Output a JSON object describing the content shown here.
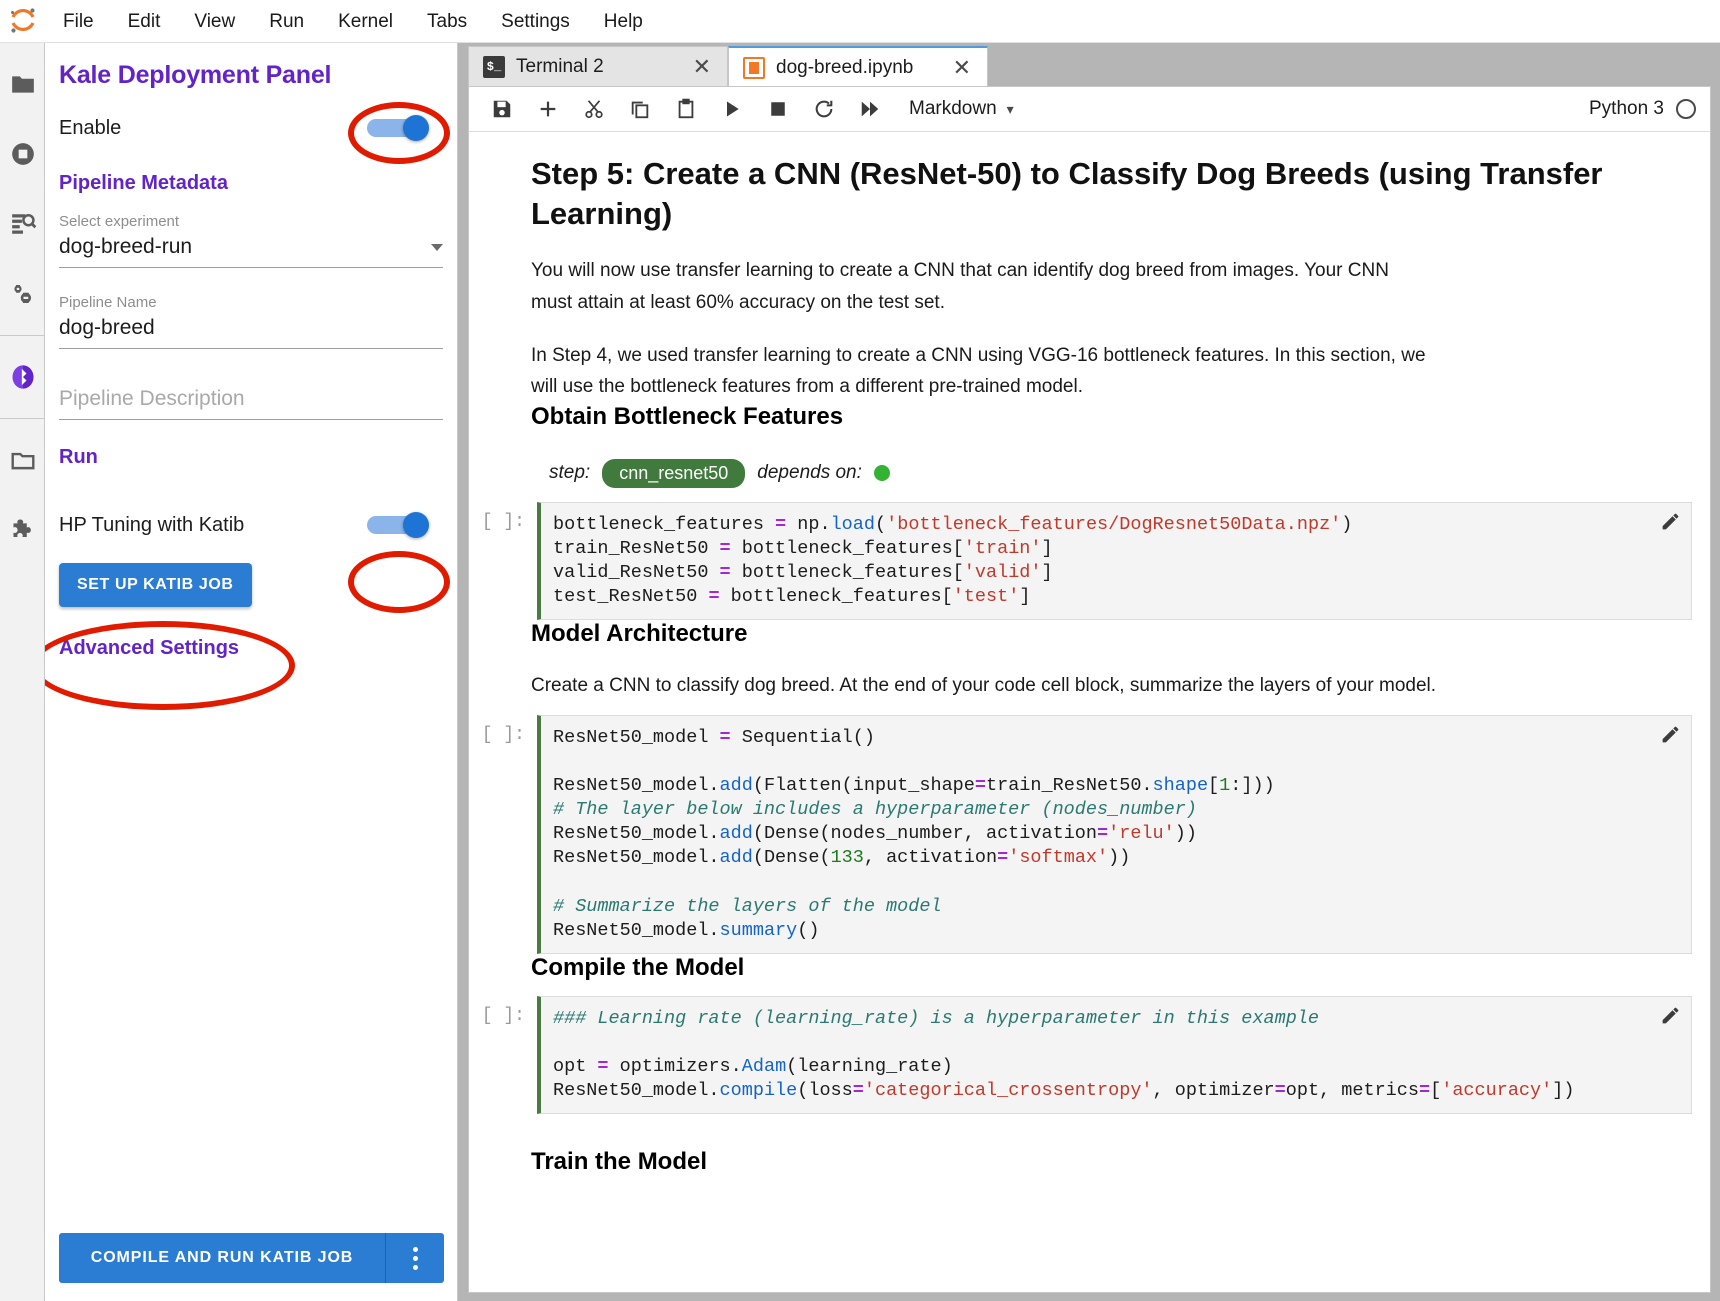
{
  "menubar": {
    "logo_name": "jupyter-logo",
    "items": [
      "File",
      "Edit",
      "View",
      "Run",
      "Kernel",
      "Tabs",
      "Settings",
      "Help"
    ]
  },
  "activitybar": {
    "items": [
      {
        "name": "file-browser-icon",
        "label": "Folder"
      },
      {
        "name": "running-terminals-icon",
        "label": "Running"
      },
      {
        "name": "command-palette-icon",
        "label": "Commands"
      },
      {
        "name": "property-inspector-icon",
        "label": "Property Inspector"
      },
      {
        "name": "kale-icon",
        "label": "Kale"
      },
      {
        "name": "open-tabs-icon",
        "label": "Tabs"
      },
      {
        "name": "extension-manager-icon",
        "label": "Extensions"
      }
    ]
  },
  "kale": {
    "title": "Kale Deployment Panel",
    "enable_label": "Enable",
    "enable_state": "on",
    "metadata_heading": "Pipeline Metadata",
    "experiment_label": "Select experiment",
    "experiment_value": "dog-breed-run",
    "pipeline_name_label": "Pipeline Name",
    "pipeline_name_value": "dog-breed",
    "pipeline_description_placeholder": "Pipeline Description",
    "pipeline_description_value": "",
    "run_heading": "Run",
    "katib_label": "HP Tuning with Katib",
    "katib_state": "on",
    "setup_katib_button": "SET UP KATIB JOB",
    "advanced_settings": "Advanced Settings",
    "compile_run_button": "COMPILE AND RUN KATIB JOB",
    "kebab_name": "more-options-icon",
    "accent_color": "#6223c8",
    "button_color": "#2b7cd3",
    "annotation_color": "#e01b00"
  },
  "tabs": [
    {
      "label": "Terminal 2",
      "icon": "terminal-icon",
      "active": false,
      "closable": true,
      "close_glyph": "✕"
    },
    {
      "label": "dog-breed.ipynb",
      "icon": "notebook-icon",
      "active": true,
      "closable": true,
      "close_glyph": "✕"
    }
  ],
  "toolbar": {
    "buttons": [
      {
        "name": "save-icon",
        "title": "Save"
      },
      {
        "name": "insert-cell-icon",
        "title": "Insert"
      },
      {
        "name": "cut-icon",
        "title": "Cut"
      },
      {
        "name": "copy-icon",
        "title": "Copy"
      },
      {
        "name": "paste-icon",
        "title": "Paste"
      },
      {
        "name": "run-icon",
        "title": "Run"
      },
      {
        "name": "stop-icon",
        "title": "Stop"
      },
      {
        "name": "restart-icon",
        "title": "Restart"
      },
      {
        "name": "restart-run-all-icon",
        "title": "Restart and run all"
      }
    ],
    "cell_type": "Markdown",
    "cell_type_caret": "chevron-down-icon",
    "kernel_name": "Python 3",
    "kernel_status": "idle"
  },
  "notebook": {
    "title": "Step 5: Create a CNN (ResNet-50) to Classify Dog Breeds (using Transfer Learning)",
    "para1": "You will now use transfer learning to create a CNN that can identify dog breed from images. Your CNN must attain at least 60% accuracy on the test set.",
    "para2": "In Step 4, we used transfer learning to create a CNN using VGG-16 bottleneck features. In this section, we will use the bottleneck features from a different pre-trained model.",
    "h2_bottleneck": "Obtain Bottleneck Features",
    "step_label": "step:",
    "step_chip": "cnn_resnet50",
    "depends_label": "depends on:",
    "cell1_prompt": "[ ]:",
    "h2_architecture": "Model Architecture",
    "para3": "Create a CNN to classify dog breed. At the end of your code cell block, summarize the layers of your model.",
    "cell2_prompt": "[ ]:",
    "h2_compile": "Compile the Model",
    "cell3_prompt": "[ ]:",
    "h2_train": "Train the Model",
    "pencil_icon": "edit-pencil-icon"
  }
}
